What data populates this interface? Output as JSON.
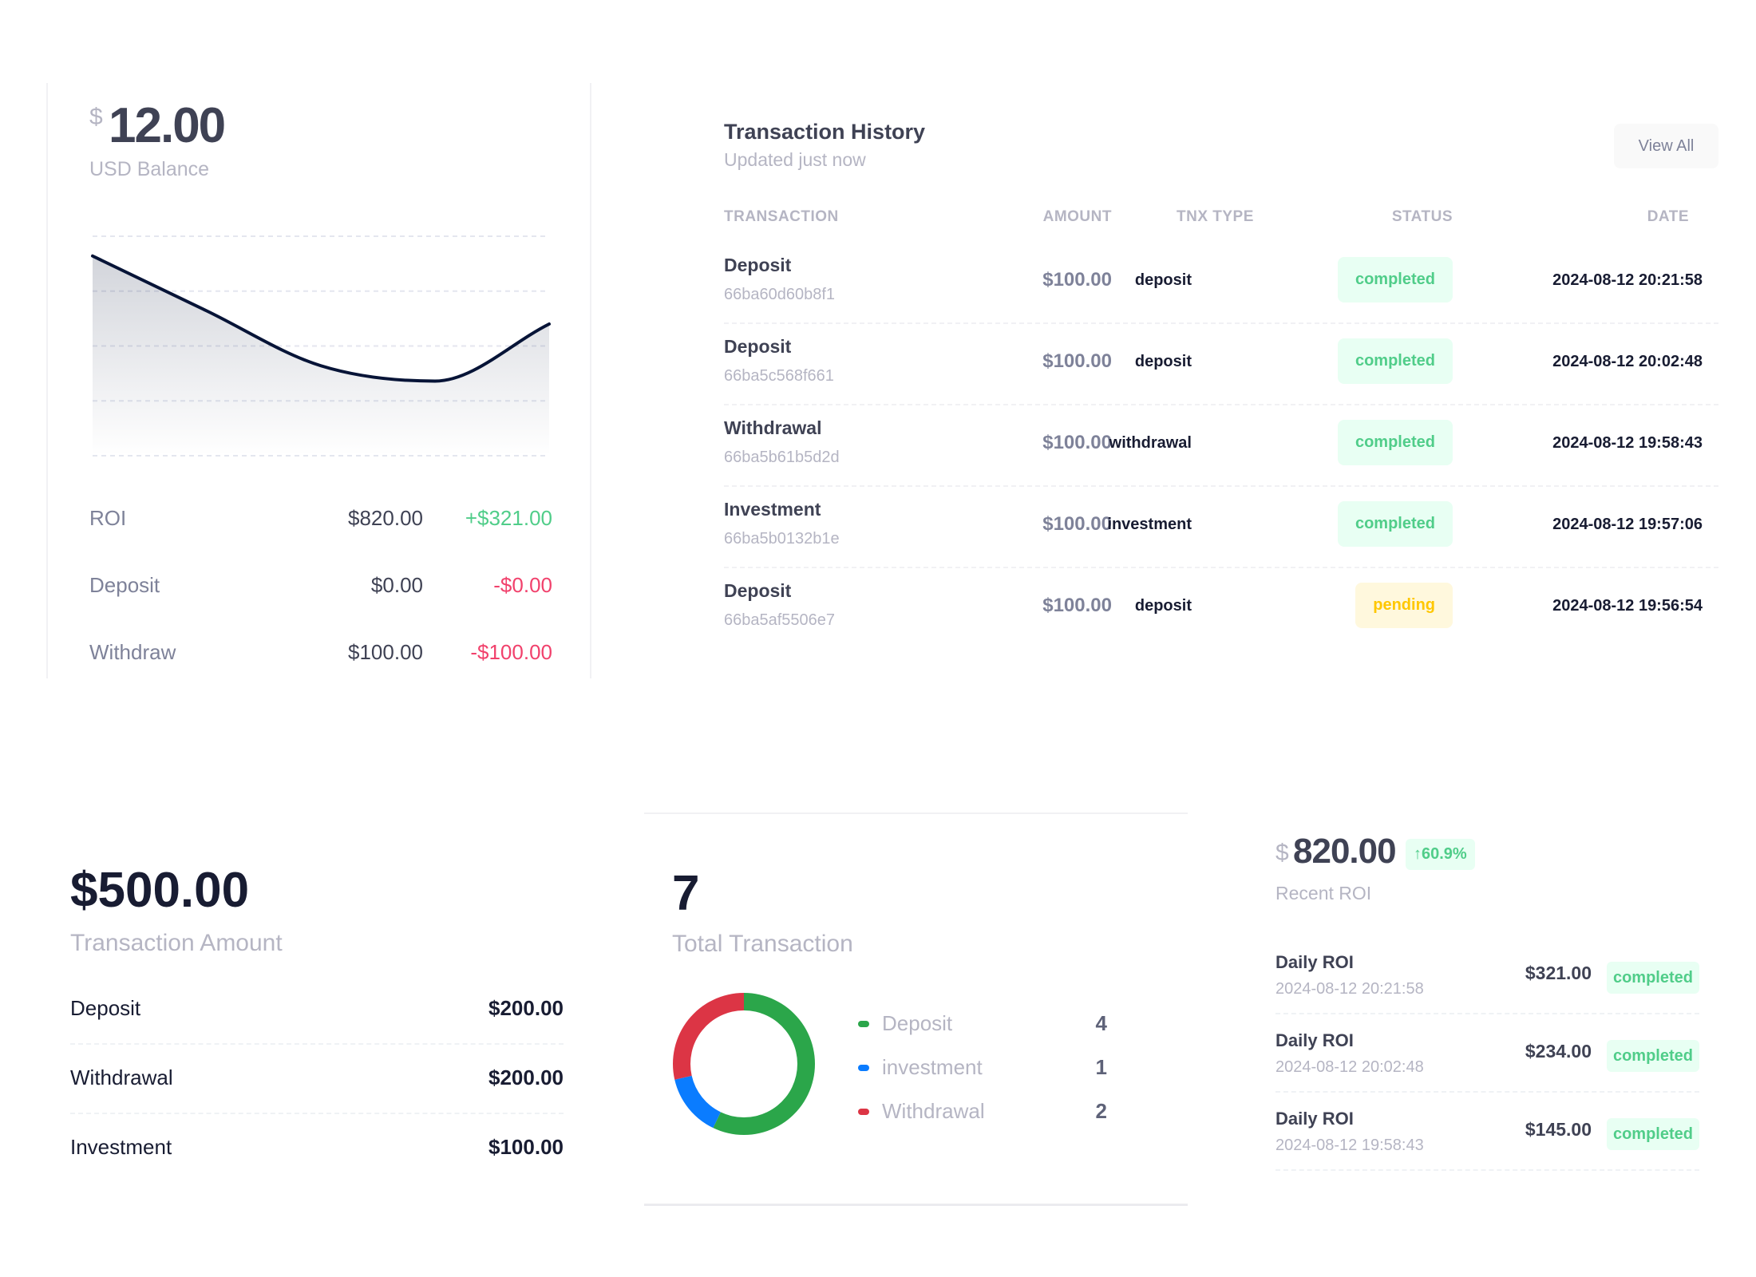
{
  "balance_card": {
    "currency_symbol": "$",
    "amount": "12.00",
    "label": "USD Balance",
    "stats": [
      {
        "label": "ROI",
        "value": "$820.00",
        "change": "+$321.00",
        "direction": "up"
      },
      {
        "label": "Deposit",
        "value": "$0.00",
        "change": "-$0.00",
        "direction": "down"
      },
      {
        "label": "Withdraw",
        "value": "$100.00",
        "change": "-$100.00",
        "direction": "down"
      }
    ]
  },
  "chart_data": {
    "type": "area",
    "title": "",
    "xlabel": "",
    "ylabel": "",
    "x": [
      0,
      1,
      2,
      3,
      4
    ],
    "series": [
      {
        "name": "USD Balance",
        "values": [
          91,
          66,
          41,
          34,
          60
        ],
        "color": "#071437"
      }
    ],
    "ylim": [
      0,
      100
    ],
    "grid": true,
    "grid_lines": 5,
    "axis_labels_visible": false
  },
  "transaction_history": {
    "title": "Transaction History",
    "subtitle": "Updated just now",
    "view_all_label": "View All",
    "columns": [
      "TRANSACTION",
      "AMOUNT",
      "TNX TYPE",
      "STATUS",
      "DATE"
    ],
    "rows": [
      {
        "name": "Deposit",
        "id": "66ba60d60b8f1",
        "amount": "$100.00",
        "type": "deposit",
        "status": "completed",
        "date": "2024-08-12 20:21:58"
      },
      {
        "name": "Deposit",
        "id": "66ba5c568f661",
        "amount": "$100.00",
        "type": "deposit",
        "status": "completed",
        "date": "2024-08-12 20:02:48"
      },
      {
        "name": "Withdrawal",
        "id": "66ba5b61b5d2d",
        "amount": "$100.00",
        "type": "withdrawal",
        "status": "completed",
        "date": "2024-08-12 19:58:43"
      },
      {
        "name": "Investment",
        "id": "66ba5b0132b1e",
        "amount": "$100.00",
        "type": "investment",
        "status": "completed",
        "date": "2024-08-12 19:57:06"
      },
      {
        "name": "Deposit",
        "id": "66ba5af5506e7",
        "amount": "$100.00",
        "type": "deposit",
        "status": "pending",
        "date": "2024-08-12 19:56:54"
      }
    ]
  },
  "transaction_amount": {
    "amount": "$500.00",
    "label": "Transaction Amount",
    "rows": [
      {
        "label": "Deposit",
        "value": "$200.00"
      },
      {
        "label": "Withdrawal",
        "value": "$200.00"
      },
      {
        "label": "Investment",
        "value": "$100.00"
      }
    ]
  },
  "total_transaction": {
    "count": "7",
    "label": "Total Transaction",
    "breakdown": [
      {
        "label": "Deposit",
        "value": 4,
        "color": "#2ba64a"
      },
      {
        "label": "investment",
        "value": 1,
        "color": "#0a7cff"
      },
      {
        "label": "Withdrawal",
        "value": 2,
        "color": "#dc3545"
      }
    ]
  },
  "recent_roi": {
    "currency_symbol": "$",
    "amount": "820.00",
    "badge": "60.9%",
    "badge_icon": "arrow-up-icon",
    "label": "Recent ROI",
    "rows": [
      {
        "title": "Daily ROI",
        "date": "2024-08-12 20:21:58",
        "amount": "$321.00",
        "status": "completed"
      },
      {
        "title": "Daily ROI",
        "date": "2024-08-12 20:02:48",
        "amount": "$234.00",
        "status": "completed"
      },
      {
        "title": "Daily ROI",
        "date": "2024-08-12 19:58:43",
        "amount": "$145.00",
        "status": "completed"
      }
    ]
  },
  "colors": {
    "positive": "#50cd89",
    "negative": "#f1416c",
    "pending": "#ffc700",
    "chart_line": "#071437"
  }
}
